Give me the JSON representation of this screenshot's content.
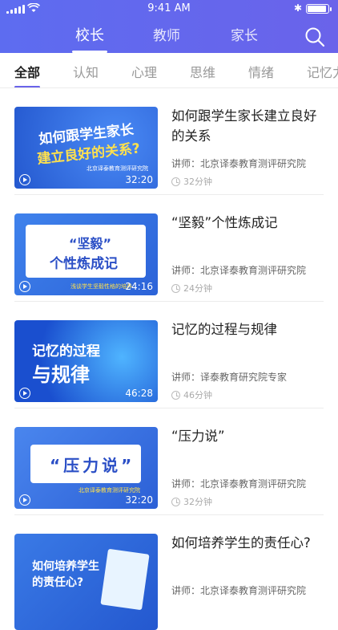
{
  "status_bar": {
    "time": "9:41 AM"
  },
  "top_tabs": [
    {
      "label": "校长",
      "active": true
    },
    {
      "label": "教师",
      "active": false
    },
    {
      "label": "家长",
      "active": false
    }
  ],
  "categories": [
    {
      "label": "全部",
      "active": true
    },
    {
      "label": "认知",
      "active": false
    },
    {
      "label": "心理",
      "active": false
    },
    {
      "label": "思维",
      "active": false
    },
    {
      "label": "情绪",
      "active": false
    },
    {
      "label": "记忆力",
      "active": false
    }
  ],
  "courses": [
    {
      "title": "如何跟学生家长建立良好的关系",
      "lecturer": "讲师：北京译泰教育测评研究院",
      "duration": "32分钟",
      "video_length": "32:20",
      "thumb_text": [
        "如何跟学生家长",
        "建立良好的关系?"
      ],
      "thumb_sub": "北京译泰教育测评研究院",
      "thumb_bg": "#2f6be0"
    },
    {
      "title": "“坚毅”个性炼成记",
      "lecturer": "讲师：北京译泰教育测评研究院",
      "duration": "24分钟",
      "video_length": "24:16",
      "thumb_text": [
        "“坚毅”",
        "个性炼成记"
      ],
      "thumb_sub": "浅谈学生坚毅性格的培养",
      "thumb_bg": "#3a7ae6"
    },
    {
      "title": "记忆的过程与规律",
      "lecturer": "讲师：译泰教育研究院专家",
      "duration": "46分钟",
      "video_length": "46:28",
      "thumb_text": [
        "记忆的过程",
        "与规律"
      ],
      "thumb_sub": "",
      "thumb_bg": "#1e58d8"
    },
    {
      "title": "“压力说”",
      "lecturer": "讲师：北京译泰教育测评研究院",
      "duration": "32分钟",
      "video_length": "32:20",
      "thumb_text": [
        "“压力说”",
        ""
      ],
      "thumb_sub": "北京译泰教育测评研究院",
      "thumb_bg": "#3c6ee2"
    },
    {
      "title": "如何培养学生的责任心?",
      "lecturer": "讲师：北京译泰教育测评研究院",
      "duration": "",
      "video_length": "",
      "thumb_text": [
        "如何培养学生",
        "的责任心?"
      ],
      "thumb_sub": "",
      "thumb_bg": "#2b5fd9"
    }
  ]
}
